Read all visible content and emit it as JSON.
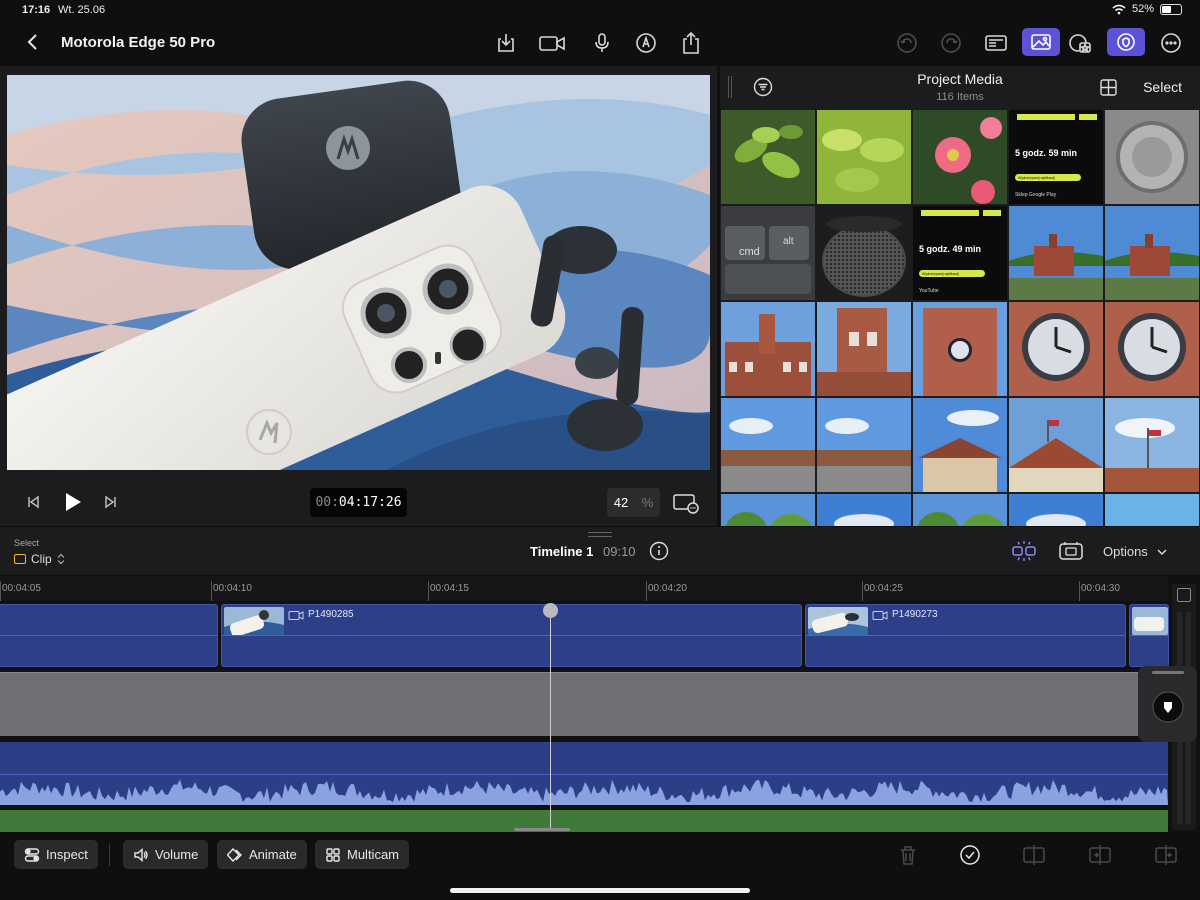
{
  "status": {
    "time": "17:16",
    "date": "Wt. 25.06",
    "battery": "52%",
    "battery_level": 0.52
  },
  "header": {
    "title": "Motorola Edge 50 Pro"
  },
  "viewer": {
    "timecode_prefix": "00:",
    "timecode_main": "04:17",
    "timecode_frames": ":26",
    "zoom": "42",
    "zoom_unit": "%"
  },
  "media": {
    "title": "Project Media",
    "count": "116 Items",
    "select_label": "Select",
    "thumbnails": [
      {
        "kind": "leaves"
      },
      {
        "kind": "leaves-lime"
      },
      {
        "kind": "flowers"
      },
      {
        "kind": "screen"
      },
      {
        "kind": "metal"
      },
      {
        "kind": "keyboard"
      },
      {
        "kind": "speaker"
      },
      {
        "kind": "screen"
      },
      {
        "kind": "city"
      },
      {
        "kind": "city"
      },
      {
        "kind": "brick"
      },
      {
        "kind": "brick-tower"
      },
      {
        "kind": "brick-clock"
      },
      {
        "kind": "clock"
      },
      {
        "kind": "clock"
      },
      {
        "kind": "sky-square"
      },
      {
        "kind": "sky-square"
      },
      {
        "kind": "sky-building"
      },
      {
        "kind": "sky-roof"
      },
      {
        "kind": "sky-flag"
      },
      {
        "kind": "trees"
      },
      {
        "kind": "sky"
      },
      {
        "kind": "trees"
      },
      {
        "kind": "sky"
      },
      {
        "kind": "colorful"
      }
    ],
    "screen_lines": [
      "5 godz. 59 min",
      "Wykorzystaj aplikacji",
      "Sklep Google Play",
      "5 godz. 49 min",
      "YouTube"
    ],
    "keyboard_keys": [
      "cmd",
      "alt"
    ]
  },
  "timeline": {
    "select_label": "Select",
    "mode": "Clip",
    "name": "Timeline 1",
    "duration": "09:10",
    "options_label": "Options",
    "ruler": [
      "00:04:05",
      "00:04:10",
      "00:04:15",
      "00:04:20",
      "00:04:25",
      "00:04:30"
    ],
    "clips": [
      {
        "name": ""
      },
      {
        "name": "P1490285"
      },
      {
        "name": "P1490273"
      },
      {
        "name": ""
      }
    ]
  },
  "toolbar": {
    "inspect": "Inspect",
    "volume": "Volume",
    "animate": "Animate",
    "multicam": "Multicam"
  },
  "colors": {
    "accent": "#5b52d6",
    "clip_blue": "#2d3f88",
    "audio_green": "#3f7a3a"
  }
}
